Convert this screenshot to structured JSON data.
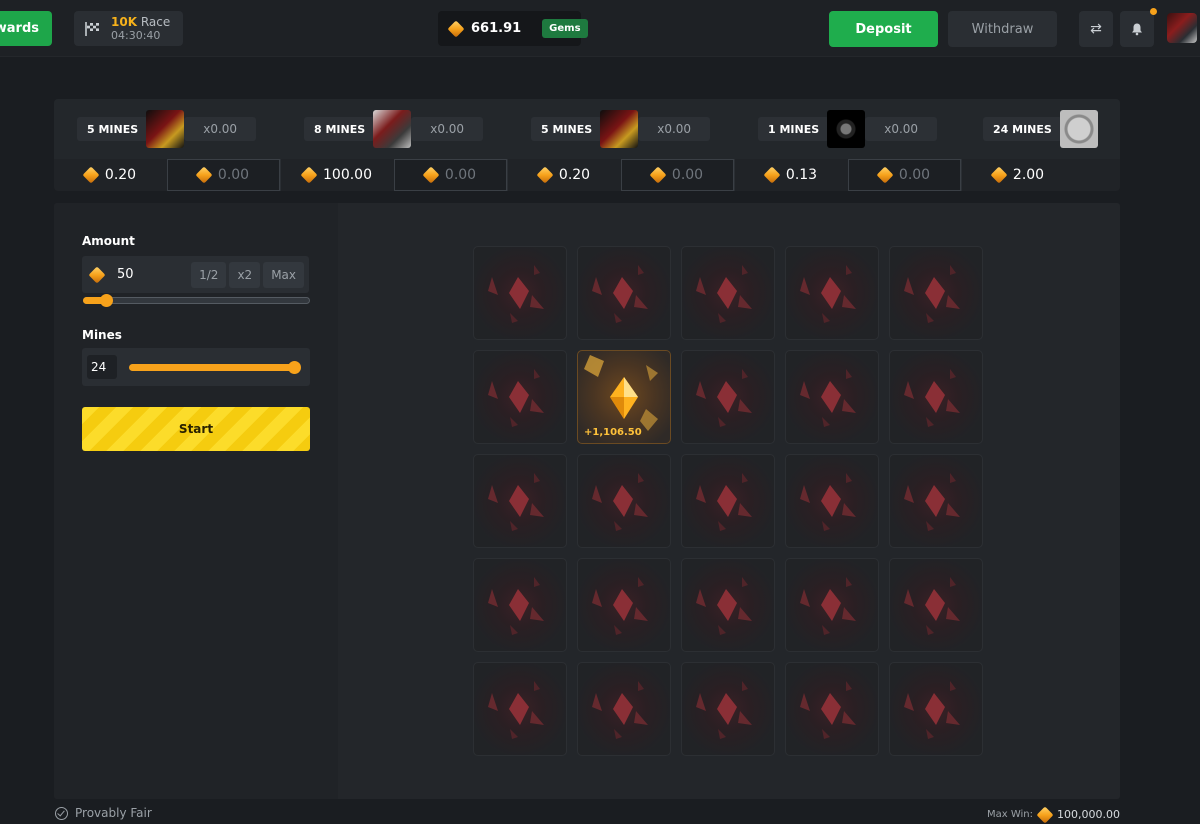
{
  "topbar": {
    "rewards_label": "ewards",
    "race": {
      "amount": "10K",
      "label": "Race",
      "timer": "04:30:40"
    },
    "balance": {
      "value": "661.91",
      "currency_badge": "Gems"
    },
    "deposit_label": "Deposit",
    "withdraw_label": "Withdraw",
    "icons": [
      "swap-icon",
      "bell-icon"
    ],
    "has_notification": true
  },
  "recent_bets": [
    {
      "mines_label": "5 MINES",
      "multiplier": "x0.00",
      "wager": "0.20",
      "payout": "0.00"
    },
    {
      "mines_label": "8 MINES",
      "multiplier": "x0.00",
      "wager": "100.00",
      "payout": "0.00"
    },
    {
      "mines_label": "5 MINES",
      "multiplier": "x0.00",
      "wager": "0.20",
      "payout": "0.00"
    },
    {
      "mines_label": "1 MINES",
      "multiplier": "x0.00",
      "wager": "0.13",
      "payout": "0.00"
    },
    {
      "mines_label": "24 MINES",
      "multiplier": "",
      "wager": "2.00",
      "payout": ""
    }
  ],
  "controls": {
    "amount_label": "Amount",
    "amount_value": "50",
    "half_label": "1/2",
    "double_label": "x2",
    "max_label": "Max",
    "amount_slider_fraction": 0.1,
    "mines_label": "Mines",
    "mines_value": "24",
    "mines_slider_fraction": 1.0,
    "start_label": "Start"
  },
  "board": {
    "rows": 5,
    "cols": 5,
    "revealed": {
      "row": 1,
      "col": 1,
      "win_text": "+1,106.50"
    }
  },
  "footer": {
    "provably_fair_label": "Provably Fair",
    "max_win_label": "Max Win:",
    "max_win_value": "100,000.00"
  },
  "colors": {
    "accent_green": "#1fad4d",
    "accent_orange": "#f7a21b",
    "start_yellow": "#f5cc0f",
    "background": "#1a1d21"
  }
}
